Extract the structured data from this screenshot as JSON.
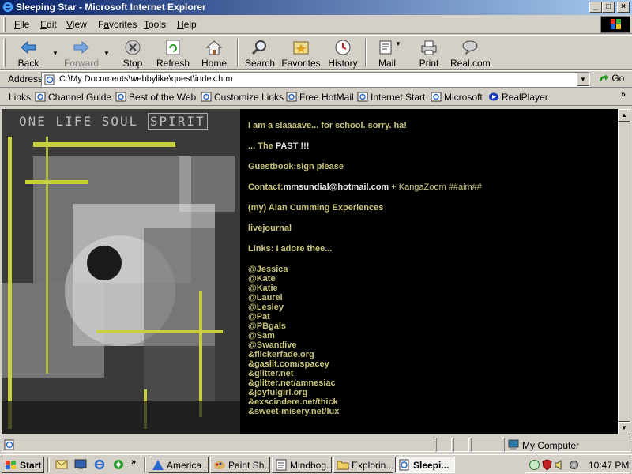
{
  "window": {
    "title": "Sleeping Star - Microsoft Internet Explorer",
    "controls": {
      "minimize": "_",
      "maximize": "□",
      "close": "×"
    }
  },
  "menu": {
    "items": [
      {
        "label": "File",
        "accel": "F",
        "rest": "ile"
      },
      {
        "label": "Edit",
        "accel": "E",
        "rest": "dit"
      },
      {
        "label": "View",
        "accel": "V",
        "rest": "iew"
      },
      {
        "label": "Favorites",
        "accel": "a",
        "pre": "F",
        "rest": "vorites"
      },
      {
        "label": "Tools",
        "accel": "T",
        "rest": "ools"
      },
      {
        "label": "Help",
        "accel": "H",
        "rest": "elp"
      }
    ]
  },
  "toolbar": {
    "back": "Back",
    "forward": "Forward",
    "stop": "Stop",
    "refresh": "Refresh",
    "home": "Home",
    "search": "Search",
    "favorites": "Favorites",
    "history": "History",
    "mail": "Mail",
    "print": "Print",
    "realcom": "Real.com"
  },
  "address": {
    "label": "Address",
    "value": "C:\\My Documents\\webbylike\\quest\\index.htm",
    "go": "Go"
  },
  "links": {
    "label": "Links",
    "items": [
      "Channel Guide",
      "Best of the Web",
      "Customize Links",
      "Free HotMail",
      "Internet Start",
      "Microsoft",
      "RealPlayer"
    ],
    "more": "»"
  },
  "page": {
    "collage_words": [
      "ONE",
      "LIFE",
      "SOUL",
      "SPIRIT"
    ],
    "line1": "I am a slaaaave... for school. sorry. ha!",
    "line2_pre": "... The ",
    "line2_bold": "PAST !!!",
    "line3": "Guestbook:sign please",
    "line4_a": "Contact:",
    "line4_email": "mmsundial@hotmail.com",
    "line4_b": " + KangaZoom ##aim##",
    "line5": "(my) Alan Cumming Experiences",
    "line6": "livejournal",
    "line7": "Links: I adore thee...",
    "link_list": [
      "@Jessica",
      "@Kate",
      "@Katie",
      "@Laurel",
      "@Lesley",
      "@Pat",
      "@PBgals",
      "@Sam",
      "@Swandive",
      "&flickerfade.org",
      "&gaslit.com/spacey",
      "&glitter.net",
      "&glitter.net/amnesiac",
      "&joyfulgirl.org",
      "&exscindere.net/thick",
      "&sweet-misery.net/lux"
    ]
  },
  "status": {
    "zone": "My Computer"
  },
  "taskbar": {
    "start": "Start",
    "quicklaunch_more": "»",
    "tasks": [
      "America ...",
      "Paint Sh...",
      "Mindbog...",
      "Explorin...",
      "Sleepi..."
    ],
    "clock": "10:47 PM"
  },
  "colors": {
    "page_text": "#c8c47a",
    "page_bg": "#000000",
    "titlebar_start": "#0a246a",
    "titlebar_end": "#a6caf0"
  }
}
